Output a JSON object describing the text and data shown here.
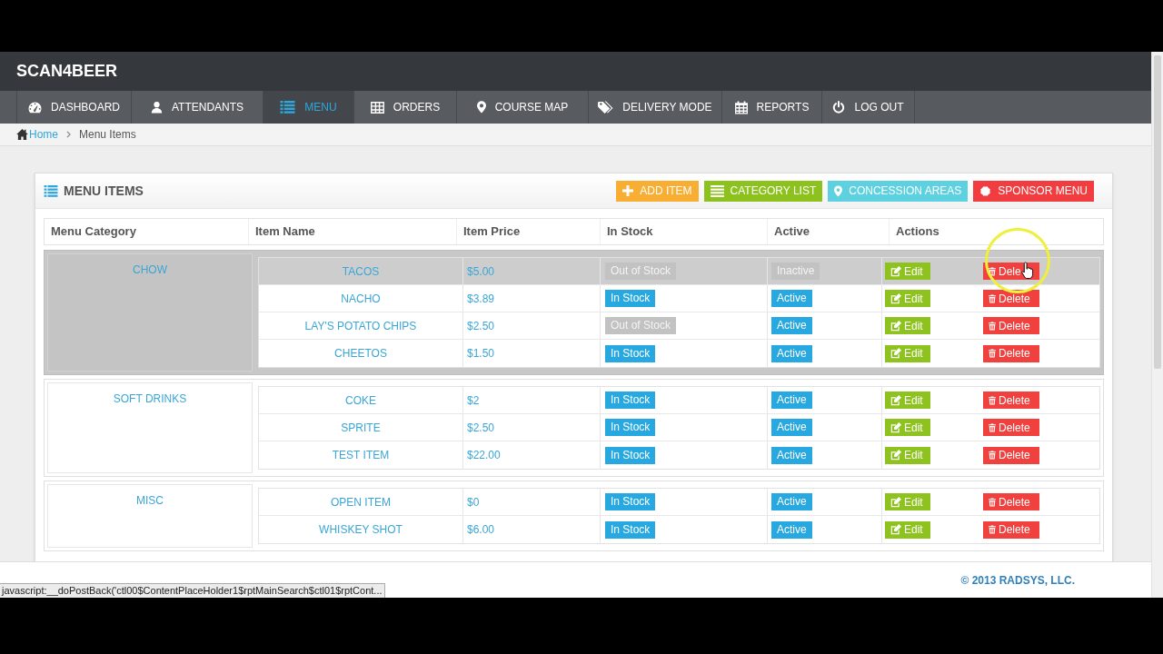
{
  "header": {
    "title": "SCAN4BEER"
  },
  "nav": [
    {
      "label": "DASHBOARD",
      "kind": "dashboard",
      "selected": false
    },
    {
      "label": "ATTENDANTS",
      "kind": "attendants",
      "selected": false
    },
    {
      "label": "MENU",
      "kind": "menu",
      "selected": true
    },
    {
      "label": "ORDERS",
      "kind": "orders",
      "selected": false
    },
    {
      "label": "COURSE MAP",
      "kind": "map",
      "selected": false
    },
    {
      "label": "DELIVERY MODE",
      "kind": "delivery",
      "selected": false
    },
    {
      "label": "REPORTS",
      "kind": "reports",
      "selected": false
    },
    {
      "label": "LOG OUT",
      "kind": "logout",
      "selected": false
    }
  ],
  "breadcrumb": {
    "home": "Home",
    "current": "Menu Items"
  },
  "panel": {
    "title": "MENU ITEMS",
    "buttons": [
      {
        "label": "ADD ITEM",
        "kind": "add",
        "color": "#f8ae33"
      },
      {
        "label": "CATEGORY LIST",
        "kind": "categories",
        "color": "#8cc11e"
      },
      {
        "label": "CONCESSION AREAS",
        "kind": "areas",
        "color": "#5dd1e0"
      },
      {
        "label": "SPONSOR MENU",
        "kind": "sponsor",
        "color": "#f13d40"
      }
    ]
  },
  "table": {
    "columns": [
      "Menu Category",
      "Item Name",
      "Item Price",
      "In Stock",
      "Active",
      "Actions"
    ],
    "groups": [
      {
        "category": "CHOW",
        "highlighted": true,
        "items": [
          {
            "name": "TACOS",
            "price": "$5.00",
            "highlighted": true,
            "stock": {
              "label": "Out of Stock",
              "on": false
            },
            "active": {
              "label": "Inactive",
              "on": false
            },
            "actions": [
              {
                "kind": "edit",
                "label": "Edit"
              },
              {
                "kind": "delete",
                "label": "Dele"
              }
            ]
          },
          {
            "name": "NACHO",
            "price": "$3.89",
            "highlighted": false,
            "stock": {
              "label": "In Stock",
              "on": true
            },
            "active": {
              "label": "Active",
              "on": true
            },
            "actions": [
              {
                "kind": "edit",
                "label": "Edit"
              },
              {
                "kind": "delete",
                "label": "Delete"
              }
            ]
          },
          {
            "name": "LAY'S POTATO CHIPS",
            "price": "$2.50",
            "highlighted": false,
            "stock": {
              "label": "Out of Stock",
              "on": false
            },
            "active": {
              "label": "Active",
              "on": true
            },
            "actions": [
              {
                "kind": "edit",
                "label": "Edit"
              },
              {
                "kind": "delete",
                "label": "Delete"
              }
            ]
          },
          {
            "name": "CHEETOS",
            "price": "$1.50",
            "highlighted": false,
            "stock": {
              "label": "In Stock",
              "on": true
            },
            "active": {
              "label": "Active",
              "on": true
            },
            "actions": [
              {
                "kind": "edit",
                "label": "Edit"
              },
              {
                "kind": "delete",
                "label": "Delete"
              }
            ]
          }
        ]
      },
      {
        "category": "SOFT DRINKS",
        "highlighted": false,
        "items": [
          {
            "name": "COKE",
            "price": "$2",
            "highlighted": false,
            "stock": {
              "label": "In Stock",
              "on": true
            },
            "active": {
              "label": "Active",
              "on": true
            },
            "actions": [
              {
                "kind": "edit",
                "label": "Edit"
              },
              {
                "kind": "delete",
                "label": "Delete"
              }
            ]
          },
          {
            "name": "SPRITE",
            "price": "$2.50",
            "highlighted": false,
            "stock": {
              "label": "In Stock",
              "on": true
            },
            "active": {
              "label": "Active",
              "on": true
            },
            "actions": [
              {
                "kind": "edit",
                "label": "Edit"
              },
              {
                "kind": "delete",
                "label": "Delete"
              }
            ]
          },
          {
            "name": "TEST ITEM",
            "price": "$22.00",
            "highlighted": false,
            "stock": {
              "label": "In Stock",
              "on": true
            },
            "active": {
              "label": "Active",
              "on": true
            },
            "actions": [
              {
                "kind": "edit",
                "label": "Edit"
              },
              {
                "kind": "delete",
                "label": "Delete"
              }
            ]
          }
        ]
      },
      {
        "category": "MISC",
        "highlighted": false,
        "items": [
          {
            "name": "OPEN ITEM",
            "price": "$0",
            "highlighted": false,
            "stock": {
              "label": "In Stock",
              "on": true
            },
            "active": {
              "label": "Active",
              "on": true
            },
            "actions": [
              {
                "kind": "edit",
                "label": "Edit"
              },
              {
                "kind": "delete",
                "label": "Delete"
              }
            ]
          },
          {
            "name": "WHISKEY SHOT",
            "price": "$6.00",
            "highlighted": false,
            "stock": {
              "label": "In Stock",
              "on": true
            },
            "active": {
              "label": "Active",
              "on": true
            },
            "actions": [
              {
                "kind": "edit",
                "label": "Edit"
              },
              {
                "kind": "delete",
                "label": "Delete"
              }
            ]
          }
        ]
      }
    ]
  },
  "footer": {
    "copyright": "© 2013 RADSYS, LLC."
  },
  "status_bar": {
    "url": "javascript:__doPostBack('ctl00$ContentPlaceHolder1$rptMainSearch$ctl01$rptCont..."
  }
}
